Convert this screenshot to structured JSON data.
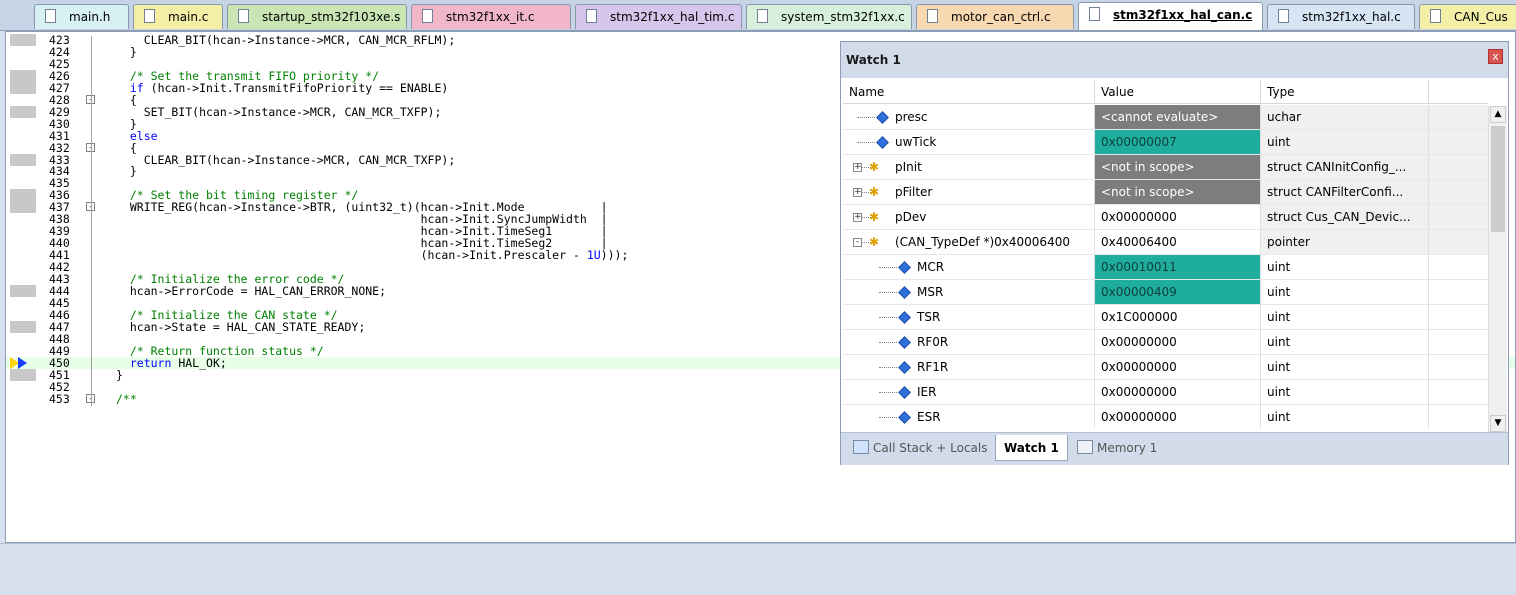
{
  "tabs": [
    {
      "label": "main.h",
      "color": "#d6f0f4"
    },
    {
      "label": "main.c",
      "color": "#f3efa6"
    },
    {
      "label": "startup_stm32f103xe.s",
      "color": "#c9e5b3"
    },
    {
      "label": "stm32f1xx_it.c",
      "color": "#f1b7c8"
    },
    {
      "label": "stm32f1xx_hal_tim.c",
      "color": "#d7c5ec"
    },
    {
      "label": "system_stm32f1xx.c",
      "color": "#d6f0dc"
    },
    {
      "label": "motor_can_ctrl.c",
      "color": "#f7d8b0"
    },
    {
      "label": "stm32f1xx_hal_can.c",
      "color": "#ffffff"
    },
    {
      "label": "stm32f1xx_hal.c",
      "color": "#d6e4f4"
    },
    {
      "label": "CAN_Cus",
      "color": "#f3efa6"
    }
  ],
  "active_tab": "stm32f1xx_hal_can.c",
  "code_lines": [
    {
      "n": "423",
      "text": "    CLEAR_BIT(hcan->Instance->MCR, CAN_MCR_RFLM);"
    },
    {
      "n": "424",
      "text": "  }"
    },
    {
      "n": "425",
      "text": ""
    },
    {
      "n": "426",
      "text": "  /* Set the transmit FIFO priority */"
    },
    {
      "n": "427",
      "text": "  if (hcan->Init.TransmitFifoPriority == ENABLE)"
    },
    {
      "n": "428",
      "text": "  {"
    },
    {
      "n": "429",
      "text": "    SET_BIT(hcan->Instance->MCR, CAN_MCR_TXFP);"
    },
    {
      "n": "430",
      "text": "  }"
    },
    {
      "n": "431",
      "text": "  else"
    },
    {
      "n": "432",
      "text": "  {"
    },
    {
      "n": "433",
      "text": "    CLEAR_BIT(hcan->Instance->MCR, CAN_MCR_TXFP);"
    },
    {
      "n": "434",
      "text": "  }"
    },
    {
      "n": "435",
      "text": ""
    },
    {
      "n": "436",
      "text": "  /* Set the bit timing register */"
    },
    {
      "n": "437",
      "text": "  WRITE_REG(hcan->Instance->BTR, (uint32_t)(hcan->Init.Mode           |"
    },
    {
      "n": "438",
      "text": "                                            hcan->Init.SyncJumpWidth  |"
    },
    {
      "n": "439",
      "text": "                                            hcan->Init.TimeSeg1       |"
    },
    {
      "n": "440",
      "text": "                                            hcan->Init.TimeSeg2       |"
    },
    {
      "n": "441",
      "text": "                                            (hcan->Init.Prescaler - 1U)));"
    },
    {
      "n": "442",
      "text": ""
    },
    {
      "n": "443",
      "text": "  /* Initialize the error code */"
    },
    {
      "n": "444",
      "text": "  hcan->ErrorCode = HAL_CAN_ERROR_NONE;"
    },
    {
      "n": "445",
      "text": ""
    },
    {
      "n": "446",
      "text": "  /* Initialize the CAN state */"
    },
    {
      "n": "447",
      "text": "  hcan->State = HAL_CAN_STATE_READY;"
    },
    {
      "n": "448",
      "text": ""
    },
    {
      "n": "449",
      "text": "  /* Return function status */"
    },
    {
      "n": "450",
      "text": "  return HAL_OK;"
    },
    {
      "n": "451",
      "text": "}"
    },
    {
      "n": "452",
      "text": ""
    },
    {
      "n": "453",
      "text": "/**"
    }
  ],
  "current_line": "450",
  "watch": {
    "title": "Watch 1",
    "close_label": "x",
    "columns": [
      "Name",
      "Value",
      "Type"
    ],
    "rows": [
      {
        "name": "presc",
        "value": "<cannot evaluate>",
        "type": "uchar",
        "style": "gray",
        "icon": "variable-icon"
      },
      {
        "name": "uwTick",
        "value": "0x00000007",
        "type": "uint",
        "style": "teal",
        "icon": "variable-icon"
      },
      {
        "name": "pInit",
        "value": "<not in scope>",
        "type": "struct CANInitConfig_...",
        "style": "gray",
        "icon": "struct-icon"
      },
      {
        "name": "pFilter",
        "value": "<not in scope>",
        "type": "struct CANFilterConfi...",
        "style": "gray",
        "icon": "struct-icon"
      },
      {
        "name": "pDev",
        "value": "0x00000000",
        "type": "struct Cus_CAN_Devic...",
        "style": "plain",
        "icon": "struct-icon"
      },
      {
        "name": "(CAN_TypeDef *)0x40006400",
        "value": "0x40006400",
        "type": "pointer",
        "style": "plain",
        "icon": "struct-icon"
      },
      {
        "name": "MCR",
        "value": "0x00010011",
        "type": "uint",
        "style": "teal",
        "icon": "variable-icon"
      },
      {
        "name": "MSR",
        "value": "0x00000409",
        "type": "uint",
        "style": "teal",
        "icon": "variable-icon"
      },
      {
        "name": "TSR",
        "value": "0x1C000000",
        "type": "uint",
        "style": "plain",
        "icon": "variable-icon"
      },
      {
        "name": "RF0R",
        "value": "0x00000000",
        "type": "uint",
        "style": "plain",
        "icon": "variable-icon"
      },
      {
        "name": "RF1R",
        "value": "0x00000000",
        "type": "uint",
        "style": "plain",
        "icon": "variable-icon"
      },
      {
        "name": "IER",
        "value": "0x00000000",
        "type": "uint",
        "style": "plain",
        "icon": "variable-icon"
      },
      {
        "name": "ESR",
        "value": "0x00000000",
        "type": "uint",
        "style": "plain",
        "icon": "variable-icon"
      }
    ],
    "bottom_tabs": [
      "Call Stack + Locals",
      "Watch 1",
      "Memory 1"
    ],
    "active_bottom_tab": "Watch 1"
  }
}
